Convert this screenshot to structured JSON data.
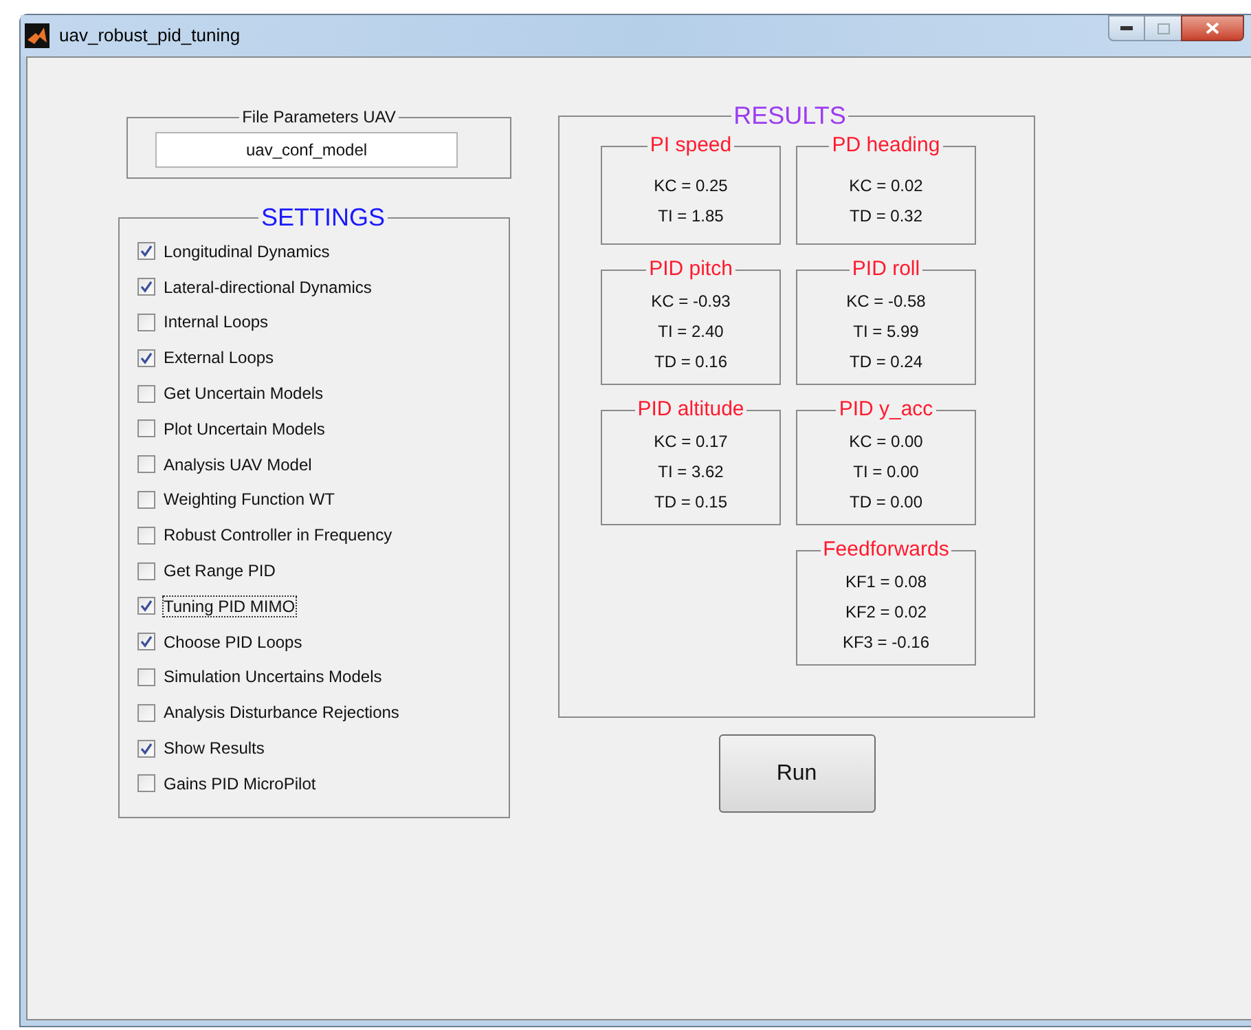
{
  "window": {
    "title": "uav_robust_pid_tuning"
  },
  "file_parameters": {
    "title": "File Parameters UAV",
    "value": "uav_conf_model"
  },
  "settings": {
    "title": "SETTINGS",
    "items": [
      {
        "label": "Longitudinal Dynamics",
        "checked": true,
        "focused": false
      },
      {
        "label": "Lateral-directional Dynamics",
        "checked": true,
        "focused": false
      },
      {
        "label": "Internal Loops",
        "checked": false,
        "focused": false
      },
      {
        "label": "External Loops",
        "checked": true,
        "focused": false
      },
      {
        "label": "Get Uncertain Models",
        "checked": false,
        "focused": false
      },
      {
        "label": "Plot Uncertain Models",
        "checked": false,
        "focused": false
      },
      {
        "label": "Analysis UAV Model",
        "checked": false,
        "focused": false
      },
      {
        "label": "Weighting Function WT",
        "checked": false,
        "focused": false
      },
      {
        "label": "Robust Controller in Frequency",
        "checked": false,
        "focused": false
      },
      {
        "label": "Get Range PID",
        "checked": false,
        "focused": false
      },
      {
        "label": "Tuning PID MIMO",
        "checked": true,
        "focused": true
      },
      {
        "label": "Choose PID Loops",
        "checked": true,
        "focused": false
      },
      {
        "label": "Simulation Uncertains Models",
        "checked": false,
        "focused": false
      },
      {
        "label": "Analysis Disturbance Rejections",
        "checked": false,
        "focused": false
      },
      {
        "label": "Show Results",
        "checked": true,
        "focused": false
      },
      {
        "label": "Gains PID MicroPilot",
        "checked": false,
        "focused": false
      }
    ]
  },
  "results": {
    "title": "RESULTS",
    "groups": [
      {
        "title": "PI speed",
        "lines": [
          "KC = 0.25",
          "TI = 1.85"
        ]
      },
      {
        "title": "PD heading",
        "lines": [
          "KC = 0.02",
          "TD = 0.32"
        ]
      },
      {
        "title": "PID pitch",
        "lines": [
          "KC = -0.93",
          "TI = 2.40",
          "TD = 0.16"
        ]
      },
      {
        "title": "PID roll",
        "lines": [
          "KC = -0.58",
          "TI = 5.99",
          "TD = 0.24"
        ]
      },
      {
        "title": "PID altitude",
        "lines": [
          "KC = 0.17",
          "TI = 3.62",
          "TD = 0.15"
        ]
      },
      {
        "title": "PID y_acc",
        "lines": [
          "KC = 0.00",
          "TI = 0.00",
          "TD = 0.00"
        ]
      },
      {
        "title": "Feedforwards",
        "lines": [
          "KF1 = 0.08",
          "KF2 = 0.02",
          "KF3 = -0.16"
        ]
      }
    ]
  },
  "run_button": {
    "label": "Run"
  }
}
